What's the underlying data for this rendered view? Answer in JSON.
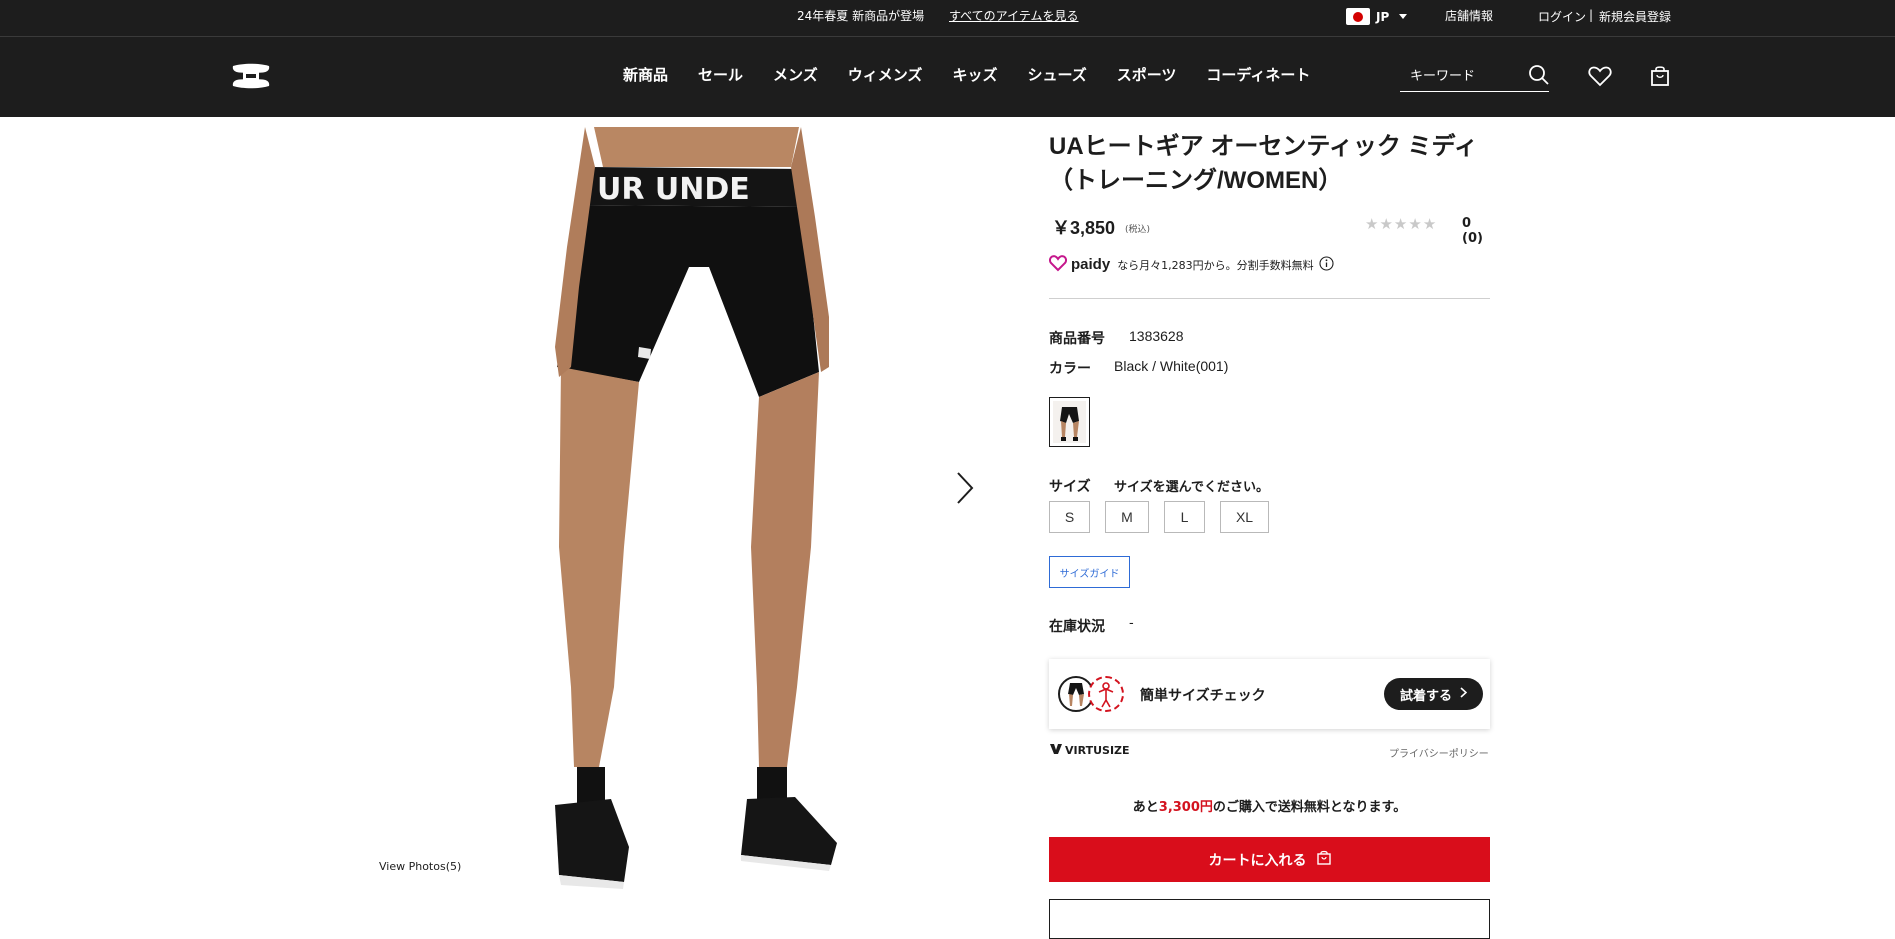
{
  "topbar": {
    "promo_text": "24年春夏 新商品が登場",
    "promo_link": "すべてのアイテムを見る",
    "region_code": "JP",
    "store_info": "店舗情報",
    "login": "ログイン",
    "separator": "|",
    "register": "新規会員登録"
  },
  "header": {
    "logo_icon": "under-armour-logo",
    "nav": [
      "新商品",
      "セール",
      "メンズ",
      "ウィメンズ",
      "キッズ",
      "シューズ",
      "スポーツ",
      "コーディネート"
    ],
    "search_placeholder": "キーワード"
  },
  "gallery": {
    "view_photos": "View Photos(5)"
  },
  "product": {
    "title": "UAヒートギア オーセンティック ミディ（トレーニング/WOMEN）",
    "price": "￥3,850",
    "tax_note": "(税込)",
    "rating_stars": 0,
    "review_count": "0",
    "review_count_paren": "(0)",
    "paidy_brand": "paidy",
    "paidy_text": "なら月々1,283円から。分割手数料無料",
    "product_number_label": "商品番号",
    "product_number": "1383628",
    "color_label": "カラー",
    "color_value": "Black / White(001)",
    "size_label": "サイズ",
    "size_prompt": "サイズを選んでください。",
    "sizes": [
      "S",
      "M",
      "L",
      "XL"
    ],
    "size_guide": "サイズガイド",
    "stock_label": "在庫状況",
    "stock_value": "-"
  },
  "virtusize": {
    "label": "簡単サイズチェック",
    "try_button": "試着する",
    "brand": "VIRTUSIZE",
    "privacy": "プライバシーポリシー"
  },
  "shipping": {
    "prefix": "あと",
    "amount": "3,300円",
    "suffix": "のご購入で送料無料となります。"
  },
  "cart": {
    "add_to_cart": "カートに入れる"
  },
  "colors": {
    "header_bg": "#1d1d1d",
    "cart_red": "#d90d1b",
    "accent_red": "#d3131f",
    "guide_blue": "#2e6bd6"
  }
}
